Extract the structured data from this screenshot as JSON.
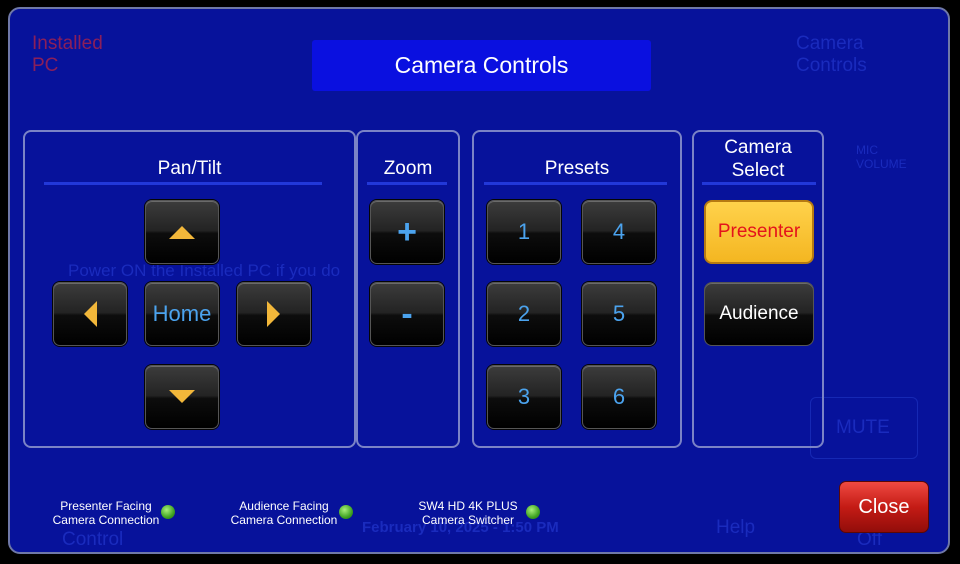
{
  "window": {
    "title": "Camera Controls"
  },
  "background": {
    "installed_pc": "Installed PC",
    "camera_controls": "Camera Controls",
    "help": "Help",
    "mute": "MUTE",
    "mic_volume": "MIC VOLUME",
    "control": "Control",
    "off": "Off",
    "date": "February 10, 2025  -  1:50 PM",
    "hint": "Power ON the Installed PC if you do"
  },
  "pan_tilt": {
    "title": "Pan/Tilt",
    "home_label": "Home",
    "up_icon": "arrow-up-icon",
    "down_icon": "arrow-down-icon",
    "left_icon": "arrow-left-icon",
    "right_icon": "arrow-right-icon"
  },
  "zoom": {
    "title": "Zoom",
    "in_label": "+",
    "out_label": "-"
  },
  "presets": {
    "title": "Presets",
    "items": [
      "1",
      "2",
      "3",
      "4",
      "5",
      "6"
    ]
  },
  "camera_select": {
    "title_line1": "Camera",
    "title_line2": "Select",
    "presenter_label": "Presenter",
    "audience_label": "Audience",
    "selected": "Presenter"
  },
  "status": {
    "presenter_line1": "Presenter Facing",
    "presenter_line2": "Camera Connection",
    "audience_line1": "Audience Facing",
    "audience_line2": "Camera Connection",
    "switcher_line1": "SW4 HD 4K PLUS",
    "switcher_line2": "Camera Switcher"
  },
  "close_label": "Close",
  "colors": {
    "background": "#07129b",
    "title_bar": "#0a10e0",
    "accent_blue": "#4ba3ee",
    "arrow_gold": "#f2b73a",
    "selected": "#f4b621",
    "close_red": "#c41b15",
    "status_green": "#3fa322"
  }
}
